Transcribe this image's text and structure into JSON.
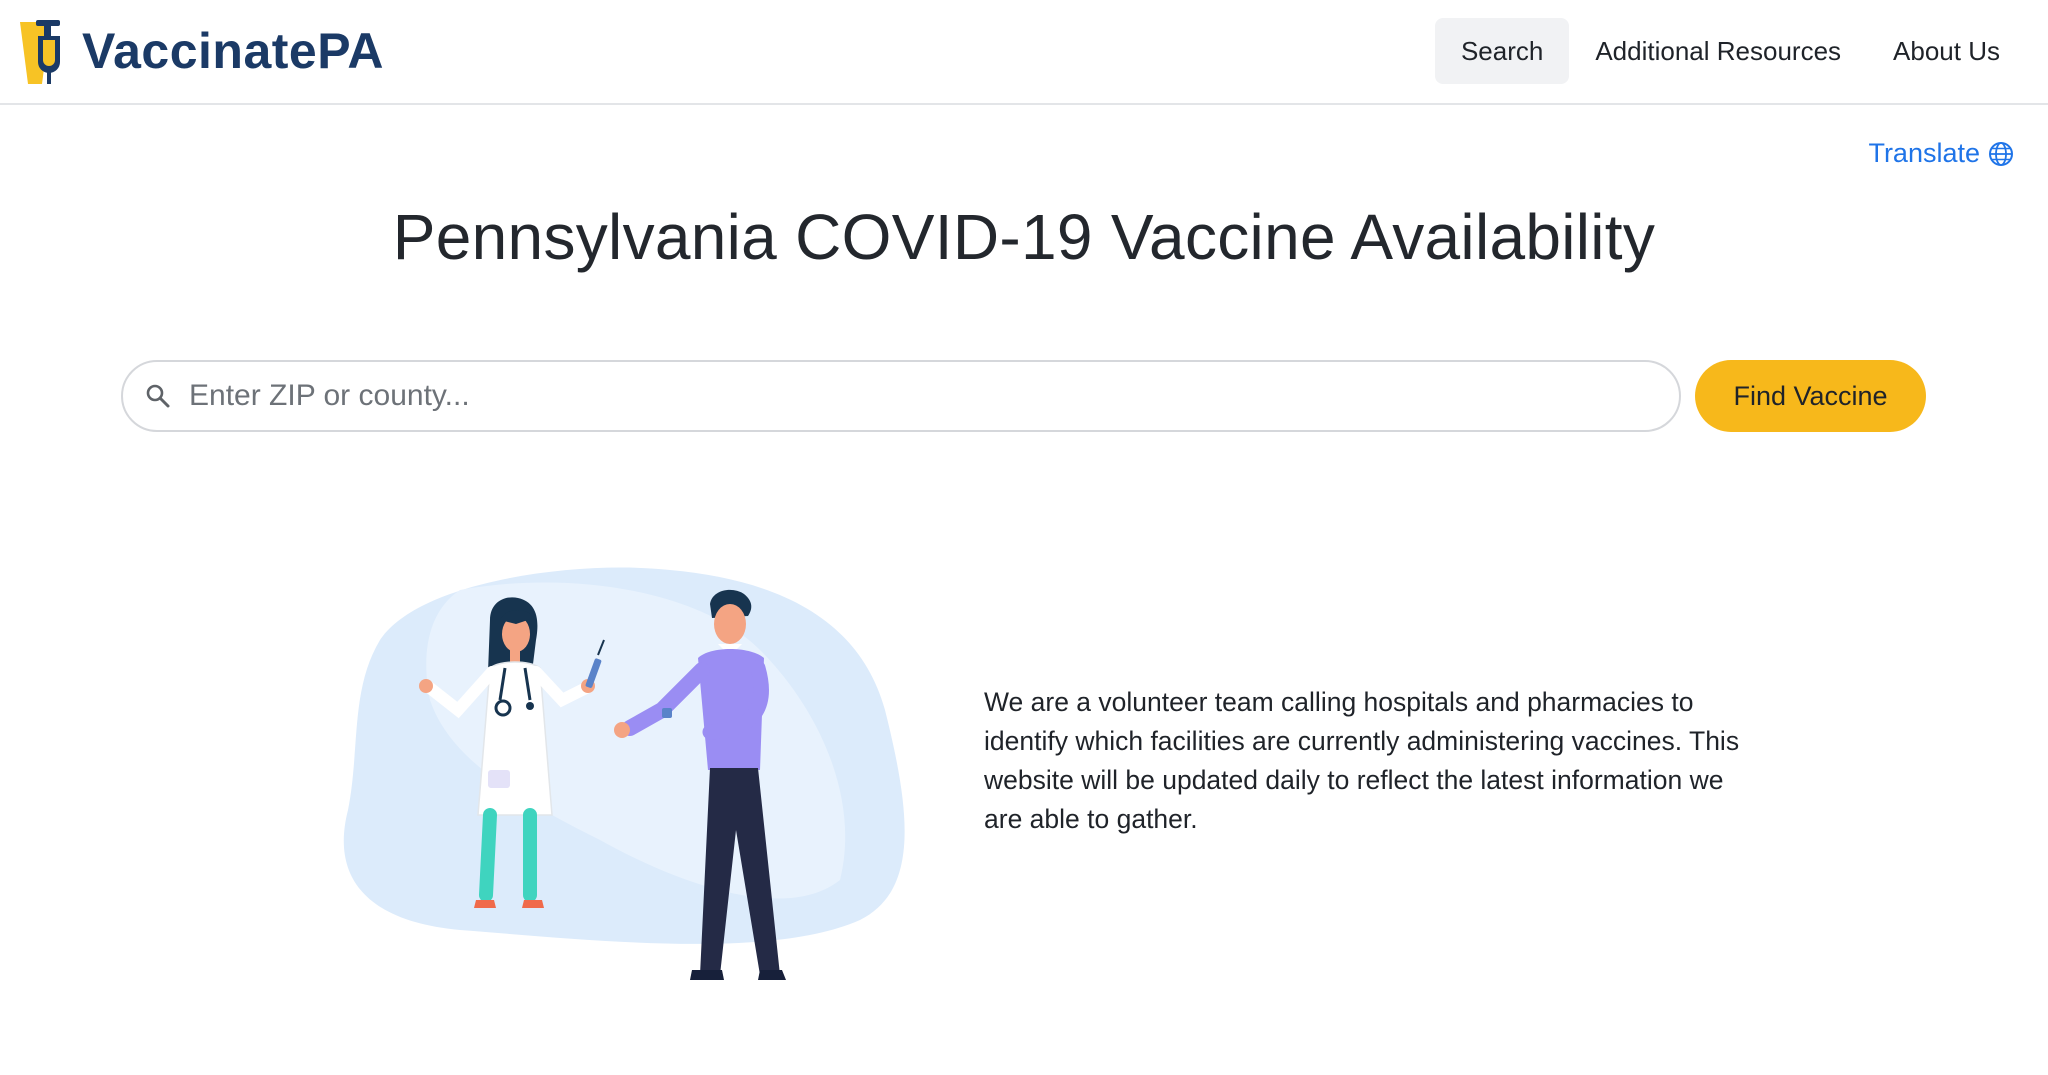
{
  "brand": {
    "name": "VaccinatePA",
    "colors": {
      "navy": "#1b3a66",
      "yellow": "#f7c325"
    }
  },
  "nav": {
    "items": [
      {
        "label": "Search",
        "active": true
      },
      {
        "label": "Additional Resources",
        "active": false
      },
      {
        "label": "About Us",
        "active": false
      }
    ]
  },
  "translate": {
    "label": "Translate",
    "icon": "globe-icon"
  },
  "main": {
    "title": "Pennsylvania COVID-19 Vaccine Availability",
    "search": {
      "placeholder": "Enter ZIP or county...",
      "value": "",
      "icon": "search-icon",
      "button_label": "Find Vaccine"
    },
    "intro": "We are a volunteer team calling hospitals and pharmacies to identify which facilities are currently administering vaccines. This website will be updated daily to reflect the latest information we are able to gather."
  },
  "colors": {
    "accent_button": "#f7b81b",
    "link": "#1f74e8",
    "nav_active_bg": "#f1f2f4",
    "illustration_bg": "#dcebfb"
  }
}
